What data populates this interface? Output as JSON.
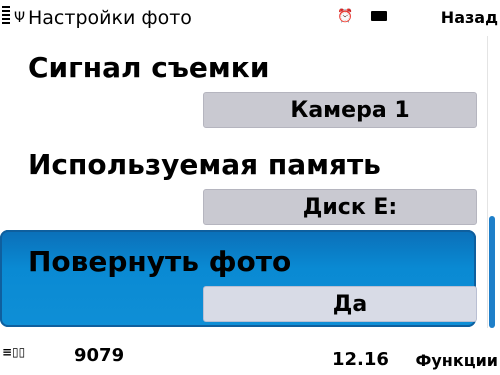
{
  "header": {
    "title": "Настройки фото",
    "back_label": "Назад",
    "icons": [
      "signal-bars-icon",
      "antenna-icon",
      "alarm-icon",
      "battery-icon"
    ]
  },
  "settings": [
    {
      "label": "Сигнал съемки",
      "value": "Камера 1",
      "selected": false
    },
    {
      "label": "Используемая память",
      "value": "Диск E:",
      "selected": false
    },
    {
      "label": "Повернуть фото",
      "value": "Да",
      "selected": true
    }
  ],
  "footer": {
    "icons": [
      "image-count-icon"
    ],
    "photo_count": "9079",
    "clock": "12.16",
    "functions_label": "Функции"
  },
  "colors": {
    "selection": "#0a8ad3",
    "value_box": "#c9c9d1",
    "scroll_thumb": "#1e7fc9"
  }
}
